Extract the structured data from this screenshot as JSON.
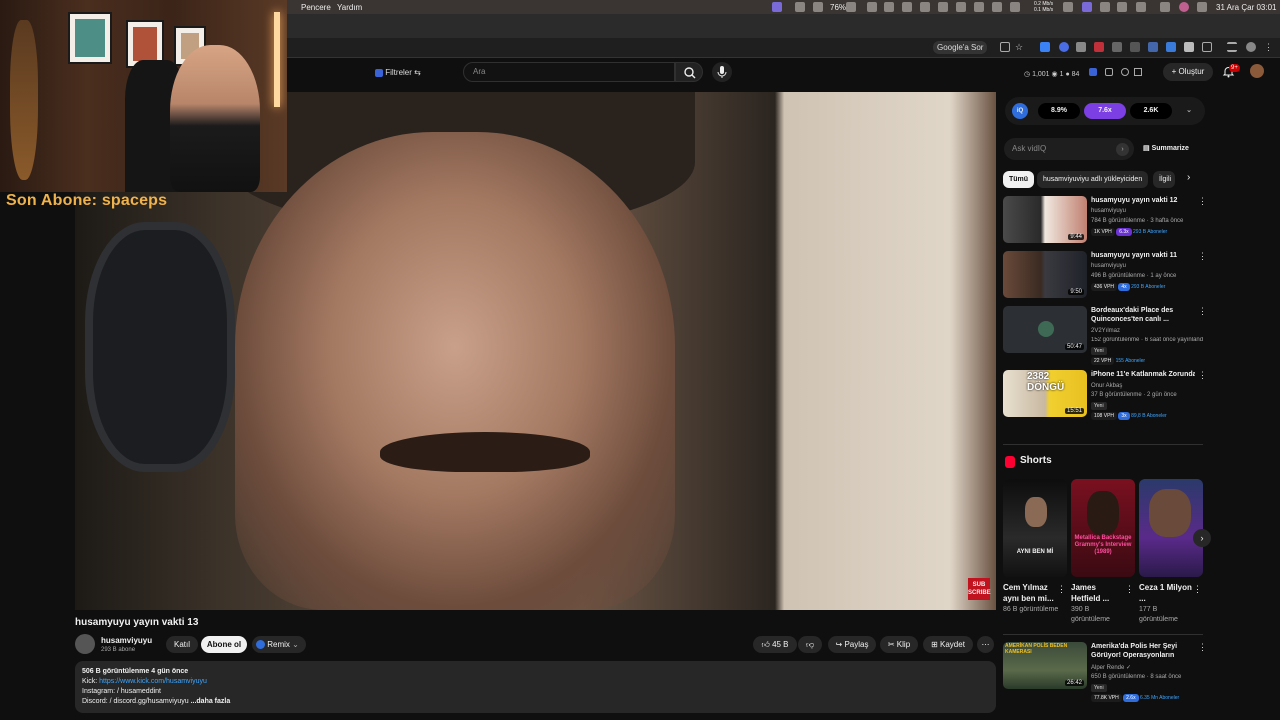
{
  "menubar": {
    "items": [
      "Pencere",
      "Yardım"
    ],
    "battery": "76%",
    "net_up": "0.2 Mb/s",
    "net_down": "0.1 Mb/s",
    "datetime": "31 Ara Çar  03:01"
  },
  "browser": {
    "google_sor": "Google'a Sor"
  },
  "header": {
    "filters_label": "Filtreler",
    "search_placeholder": "Ara",
    "stats": [
      "1,001",
      "1",
      "84"
    ],
    "create_label": "Oluştur",
    "notifications_badge": "9+"
  },
  "overlay": {
    "last_subscriber": "Son Abone: spaceps"
  },
  "video": {
    "subscribe_sticker": "SUB SCRIBE",
    "title": "husamyuyu yayın vakti 13",
    "channel_name": "husamviyuyu",
    "channel_subs": "293 B abone",
    "join_label": "Katıl",
    "subscribe_label": "Abone ol",
    "remix_label": "Remix",
    "likes": "45 B",
    "share_label": "Paylaş",
    "clip_label": "Klip",
    "save_label": "Kaydet"
  },
  "description": {
    "views_date": "506 B görüntülenme  4 gün önce",
    "kick_label": "Kick:",
    "kick_link": "https://www.kick.com/husamviyuyu",
    "instagram_line": "Instagram:   / husameddint",
    "discord_line": "Discord:   / discord.gg/husamviyuyu",
    "more": "...daha fazla"
  },
  "vidiq": {
    "logo": "iQ",
    "metrics": [
      "8.9%",
      "7.6x",
      "2.6K"
    ],
    "ask_placeholder": "Ask vidIQ",
    "summarize_label": "Summarize"
  },
  "chips": [
    "Tümü",
    "husamviyuviyu adlı yükleyiciden",
    "İlgili"
  ],
  "recommendations": [
    {
      "title": "husamyuyu yayın vakti 12",
      "channel": "husamviyuyu",
      "meta": "784 B görüntülenme · 3 hafta önce",
      "duration": "9:44",
      "vph": "1K VPH",
      "mult": "6.3x",
      "subs": "293 B Aboneler",
      "new": ""
    },
    {
      "title": "husamyuyu yayın vakti 11",
      "channel": "husamviyuyu",
      "meta": "496 B görüntülenme · 1 ay önce",
      "duration": "9:50",
      "vph": "436 VPH",
      "mult": "4x",
      "subs": "293 B Aboneler",
      "new": ""
    },
    {
      "title": "Bordeaux'daki Place des Quinconces'ten canlı ...",
      "channel": "2V2Yılmaz",
      "meta": "152 görüntülenme · 6 saat önce yayınlandı",
      "duration": "50:47",
      "vph": "22 VPH",
      "mult": "",
      "subs": "155 Aboneler",
      "new": "Yeni"
    },
    {
      "title": "iPhone 11'e Katlanmak Zorunda",
      "channel": "Onur Akbaş",
      "meta": "37 B görüntülenme · 2 gün önce",
      "duration": "15:51",
      "vph": "108 VPH",
      "mult": "3x",
      "subs": "89,8 B Aboneler",
      "new": "Yeni"
    },
    {
      "title": "Amerika'da Polis Her Şeyi Görüyor! Operasyonların Perde...",
      "channel": "Alper Rende",
      "meta": "650 B görüntülenme · 8 saat önce",
      "duration": "26:42",
      "vph": "77.8K VPH",
      "mult": "2.6x",
      "subs": "6.35 Mn Aboneler",
      "new": "Yeni"
    }
  ],
  "shorts": {
    "heading": "Shorts",
    "items": [
      {
        "title": "Cem Yılmaz aynı ben mi...",
        "views": "86 B görüntüleme",
        "overlay": "AYNI BEN Mİ"
      },
      {
        "title": "James Hetfield ...",
        "views": "390 B görüntüleme",
        "overlay": "Metallica Backstage Grammy's Interview (1989)"
      },
      {
        "title": "Ceza 1 Milyon ...",
        "views": "177 B görüntüleme",
        "overlay": ""
      }
    ]
  },
  "thumb_texts": {
    "rec4": "2382 DÖNGÜ",
    "rec5": "AMERİKAN POLİS BEDEN KAMERASI"
  }
}
